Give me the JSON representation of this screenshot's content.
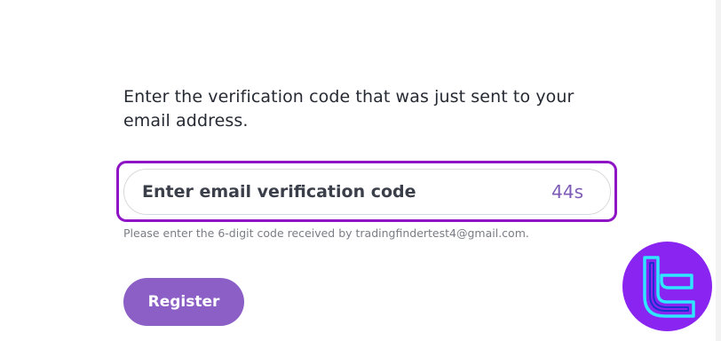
{
  "instruction": "Enter the verification code that was just sent to your email address.",
  "verification_input": {
    "placeholder": "Enter email verification code",
    "countdown": "44s"
  },
  "helper_text": "Please enter the 6-digit code received by tradingfindertest4@gmail.com.",
  "register_label": "Register",
  "colors": {
    "highlight_border": "#8e14c6",
    "countdown_text": "#7d5bb6",
    "button_background": "#8b5fc6",
    "logo_background": "#8a24f0",
    "logo_stroke": "#2ee6ff"
  },
  "icons": {
    "brand_logo": "tradingfinder-logo-icon"
  }
}
